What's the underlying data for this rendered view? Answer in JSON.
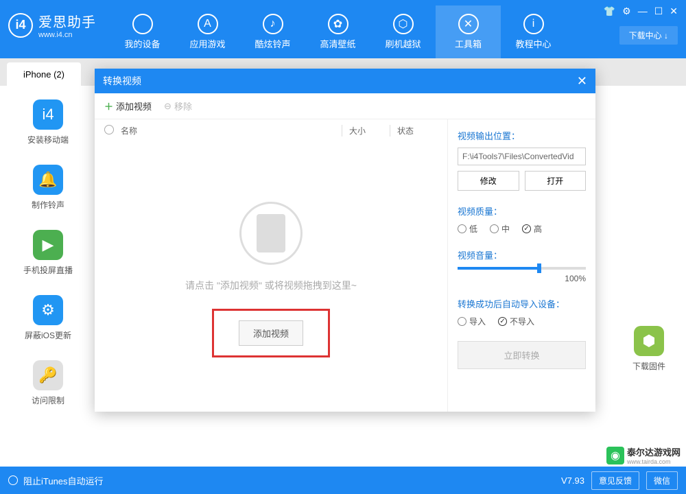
{
  "logo": {
    "badge": "i4",
    "cn": "爱思助手",
    "en": "www.i4.cn"
  },
  "nav": [
    {
      "label": "我的设备",
      "icon": ""
    },
    {
      "label": "应用游戏",
      "icon": "A"
    },
    {
      "label": "酷炫铃声",
      "icon": "♪"
    },
    {
      "label": "高清壁纸",
      "icon": "✿"
    },
    {
      "label": "刷机越狱",
      "icon": "⬡"
    },
    {
      "label": "工具箱",
      "icon": "✕"
    },
    {
      "label": "教程中心",
      "icon": "i"
    }
  ],
  "nav_active": 5,
  "header_icons": [
    "👕",
    "⚙",
    "—",
    "☐",
    "✕"
  ],
  "download_center": "下载中心 ↓",
  "tab": "iPhone (2)",
  "left_tools": [
    {
      "label": "安装移动端",
      "cls": "sb-blue",
      "icon": "i4"
    },
    {
      "label": "制作铃声",
      "cls": "sb-blue",
      "icon": "🔔"
    },
    {
      "label": "手机投屏直播",
      "cls": "sb-green",
      "icon": "▶"
    },
    {
      "label": "屏蔽iOS更新",
      "cls": "sb-blue",
      "icon": "⚙"
    },
    {
      "label": "访问限制",
      "cls": "sb-grey",
      "icon": "🔑"
    }
  ],
  "right_tool": {
    "label": "下载固件",
    "icon": "⬢"
  },
  "modal": {
    "title": "转换视频",
    "add": "添加视频",
    "remove": "移除",
    "col_name": "名称",
    "col_size": "大小",
    "col_state": "状态",
    "hint": "请点击 \"添加视频\" 或将视频拖拽到这里~",
    "add_btn": "添加视频",
    "out_label": "视频输出位置：",
    "out_path": "F:\\i4Tools7\\Files\\ConvertedVid",
    "modify": "修改",
    "open": "打开",
    "quality_label": "视频质量：",
    "q_low": "低",
    "q_mid": "中",
    "q_high": "高",
    "volume_label": "视频音量：",
    "volume": "100%",
    "import_label": "转换成功后自动导入设备：",
    "import_yes": "导入",
    "import_no": "不导入",
    "convert": "立即转换"
  },
  "status": {
    "itunes": "阻止iTunes自动运行",
    "version": "V7.93",
    "feedback": "意见反馈",
    "wechat": "微信"
  },
  "watermark": "泰尔达游戏网",
  "watermark_sub": "www.tairda.com"
}
